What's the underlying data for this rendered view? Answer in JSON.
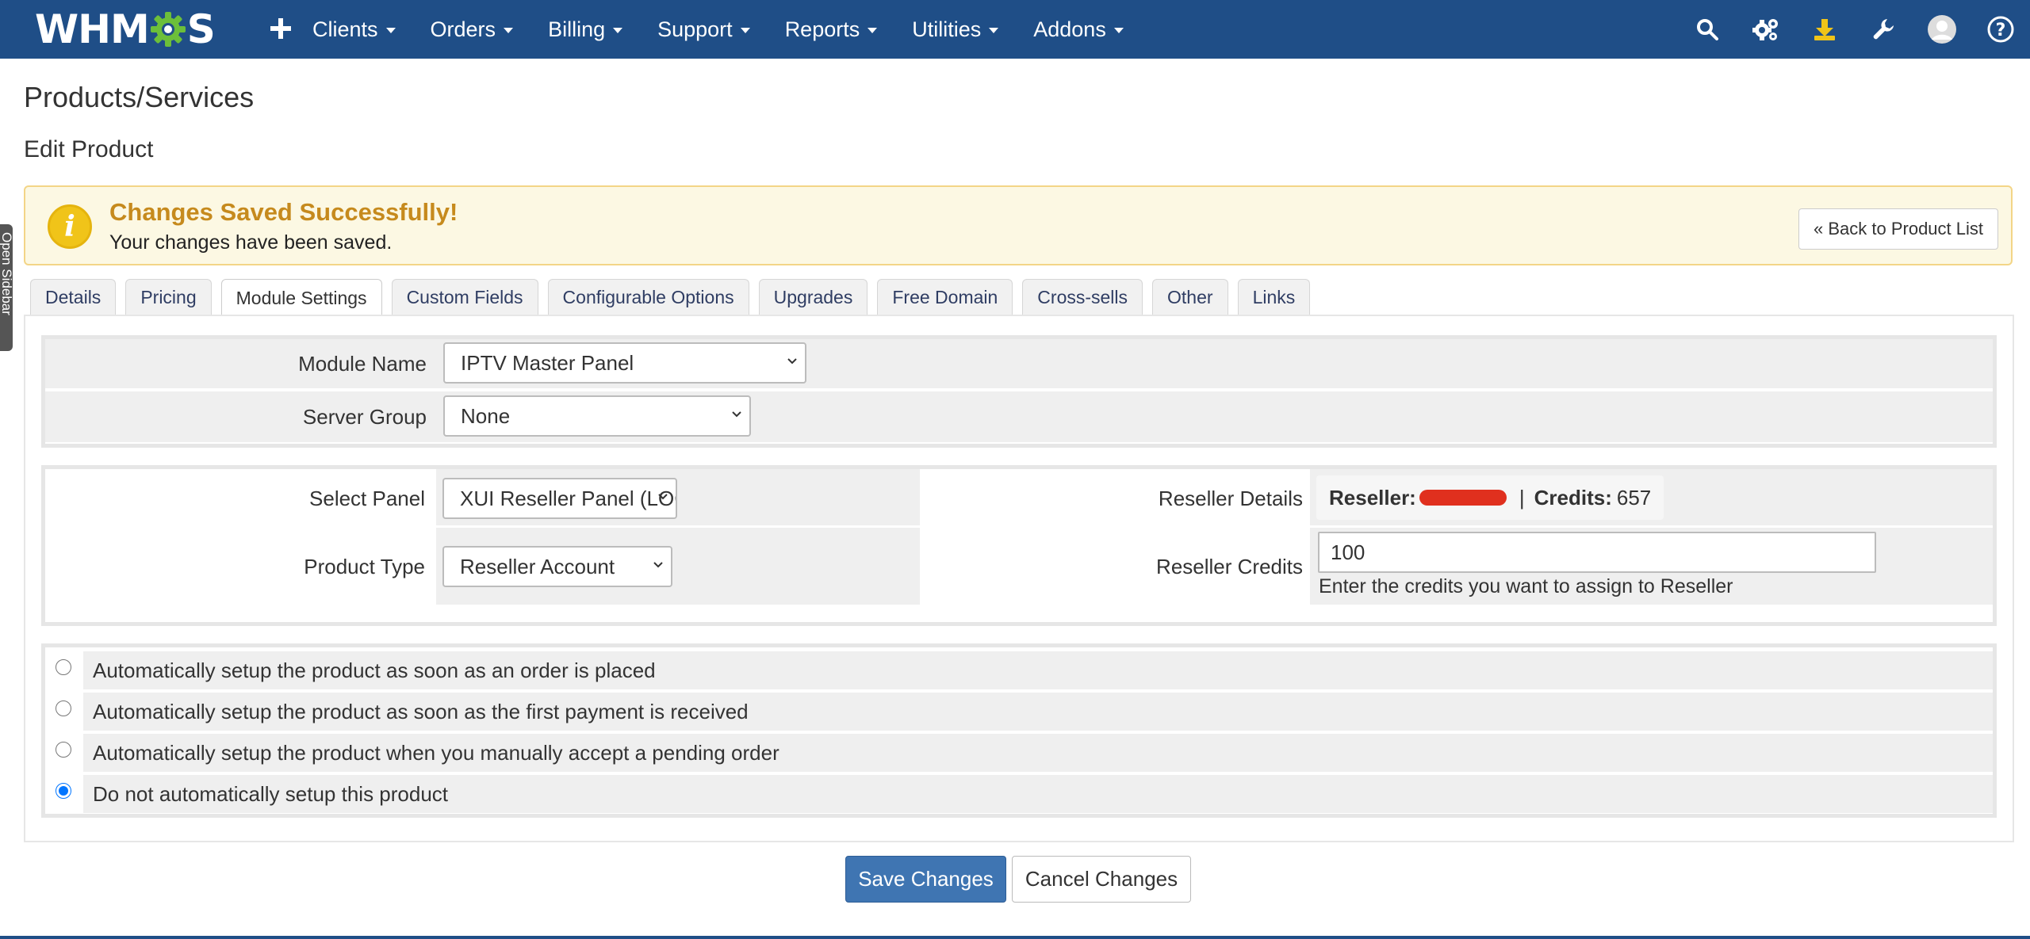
{
  "nav": {
    "logo_left": "WHM",
    "logo_right": "S",
    "add_icon": "plus-icon",
    "menu": [
      {
        "label": "Clients"
      },
      {
        "label": "Orders"
      },
      {
        "label": "Billing"
      },
      {
        "label": "Support"
      },
      {
        "label": "Reports"
      },
      {
        "label": "Utilities"
      },
      {
        "label": "Addons"
      }
    ],
    "right_icons": [
      "search-icon",
      "gears-icon",
      "download-icon",
      "wrench-icon",
      "user-avatar-icon",
      "help-icon"
    ]
  },
  "sidebar_tab": {
    "label": "Open Sidebar"
  },
  "page": {
    "title": "Products/Services",
    "subtitle": "Edit Product"
  },
  "alert": {
    "title": "Changes Saved Successfully!",
    "text": "Your changes have been saved.",
    "back_button": "« Back to Product List",
    "icon": "info-icon"
  },
  "tabs": [
    {
      "label": "Details",
      "active": false
    },
    {
      "label": "Pricing",
      "active": false
    },
    {
      "label": "Module Settings",
      "active": true
    },
    {
      "label": "Custom Fields",
      "active": false
    },
    {
      "label": "Configurable Options",
      "active": false
    },
    {
      "label": "Upgrades",
      "active": false
    },
    {
      "label": "Free Domain",
      "active": false
    },
    {
      "label": "Cross-sells",
      "active": false
    },
    {
      "label": "Other",
      "active": false
    },
    {
      "label": "Links",
      "active": false
    }
  ],
  "module": {
    "module_name_label": "Module Name",
    "module_name_value": "IPTV Master Panel",
    "server_group_label": "Server Group",
    "server_group_value": "None"
  },
  "config": {
    "select_panel_label": "Select Panel",
    "select_panel_value": "XUI Reseller Panel (LOC",
    "product_type_label": "Product Type",
    "product_type_value": "Reseller Account",
    "reseller_details_label": "Reseller Details",
    "reseller_prefix": "Reseller:",
    "separator": "|",
    "credits_label": "Credits:",
    "credits_value": "657",
    "reseller_credits_label": "Reseller Credits",
    "reseller_credits_value": "100",
    "reseller_credits_help": "Enter the credits you want to assign to Reseller"
  },
  "setup_options": [
    {
      "label": "Automatically setup the product as soon as an order is placed",
      "checked": false
    },
    {
      "label": "Automatically setup the product as soon as the first payment is received",
      "checked": false
    },
    {
      "label": "Automatically setup the product when you manually accept a pending order",
      "checked": false
    },
    {
      "label": "Do not automatically setup this product",
      "checked": true
    }
  ],
  "actions": {
    "save": "Save Changes",
    "cancel": "Cancel Changes"
  },
  "colors": {
    "nav_bg": "#1f4e87",
    "primary_button": "#3f75b2",
    "alert_bg": "#fcf8e3",
    "alert_title": "#c68a1d",
    "redaction": "#e0301e",
    "logo_gear": "#6cbf3a"
  }
}
